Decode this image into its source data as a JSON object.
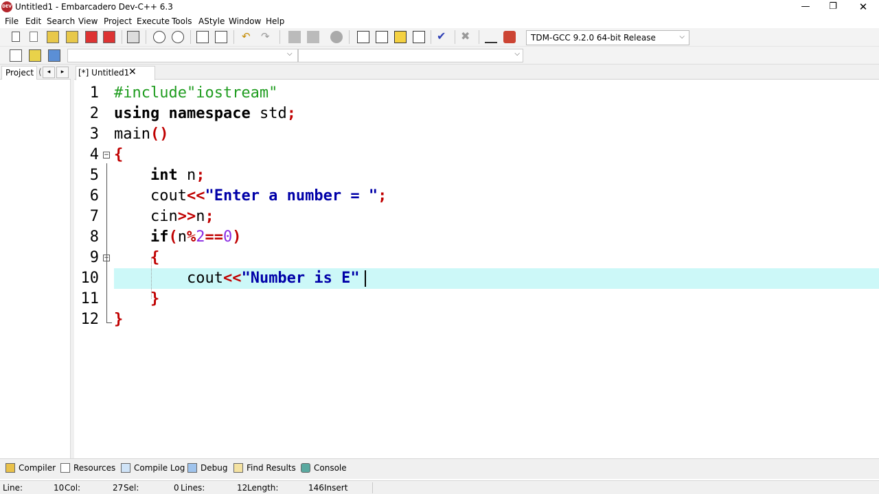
{
  "app": {
    "icon_text": "DEV",
    "title": "Untitled1 - Embarcadero Dev-C++ 6.3",
    "window_controls": {
      "minimize": "—",
      "maximize": "❐",
      "close": "✕"
    }
  },
  "menu": [
    "File",
    "Edit",
    "Search",
    "View",
    "Project",
    "Execute",
    "Tools",
    "AStyle",
    "Window",
    "Help"
  ],
  "toolbar": {
    "compiler_profile": "TDM-GCC 9.2.0 64-bit Release"
  },
  "left_panel": {
    "tab_label": "Project",
    "tab_stub": "(",
    "nav_left": "◂",
    "nav_right": "▸"
  },
  "editor_tab": {
    "label": "[*] Untitled1",
    "close": "✕"
  },
  "code_lines": [
    {
      "n": "1",
      "fold": ""
    },
    {
      "n": "2",
      "fold": ""
    },
    {
      "n": "3",
      "fold": ""
    },
    {
      "n": "4",
      "fold": "−"
    },
    {
      "n": "5",
      "fold": ""
    },
    {
      "n": "6",
      "fold": ""
    },
    {
      "n": "7",
      "fold": ""
    },
    {
      "n": "8",
      "fold": ""
    },
    {
      "n": "9",
      "fold": "−"
    },
    {
      "n": "10",
      "fold": ""
    },
    {
      "n": "11",
      "fold": ""
    },
    {
      "n": "12",
      "fold": ""
    }
  ],
  "code": {
    "l1_pre": "#include\"iostream\"",
    "l2_using": "using",
    "l2_namespace": "namespace",
    "l2_std": " std",
    "l2_semi": ";",
    "l3_main": "main",
    "l3_parens": "()",
    "l4_brace": "{",
    "l5_int": "int",
    "l5_n": " n",
    "l5_semi": ";",
    "l6_cout": "cout",
    "l6_op": "<<",
    "l6_str": "\"Enter a number = \"",
    "l6_semi": ";",
    "l7_cin": "cin",
    "l7_op": ">>",
    "l7_n": "n",
    "l7_semi": ";",
    "l8_if": "if",
    "l8_open": "(",
    "l8_n": "n",
    "l8_mod": "%",
    "l8_two": "2",
    "l8_eq": "==",
    "l8_zero": "0",
    "l8_close": ")",
    "l9_brace": "{",
    "l10_cout": "cout",
    "l10_op": "<<",
    "l10_str": "\"Number is E\"",
    "l11_brace": "}",
    "l12_brace": "}"
  },
  "bottom_tabs": [
    "Compiler",
    "Resources",
    "Compile Log",
    "Debug",
    "Find Results",
    "Console"
  ],
  "status": {
    "line_label": "Line:",
    "line_value": "10",
    "col_label": "Col:",
    "col_value": "27",
    "sel_label": "Sel:",
    "sel_value": "0",
    "lines_label": "Lines:",
    "lines_value": "12",
    "length_label": "Length:",
    "length_value": "146",
    "mode": "Insert"
  }
}
